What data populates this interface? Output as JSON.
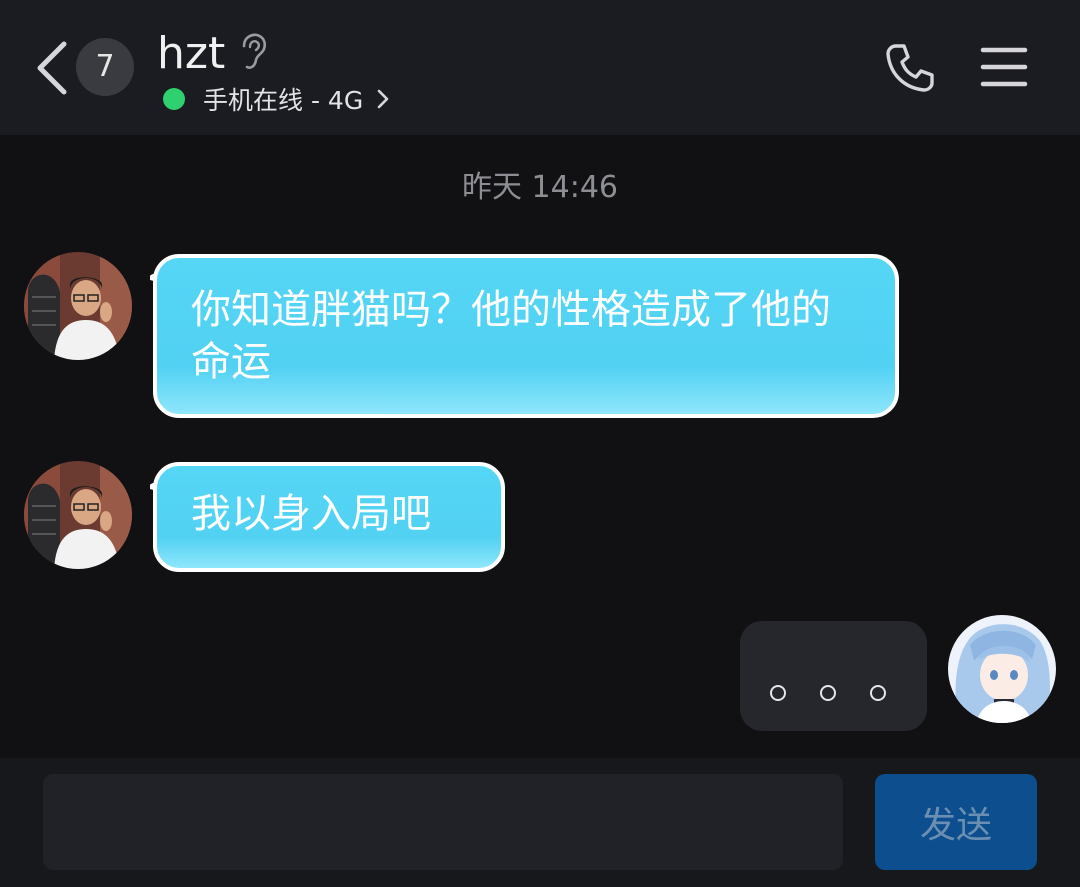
{
  "header": {
    "unread_count": "7",
    "contact_name": "hzt",
    "status_text": "手机在线 - 4G"
  },
  "chat": {
    "timestamp": "昨天 14:46",
    "messages": [
      {
        "sender": "hzt",
        "text": "你知道胖猫吗？他的性格造成了他的命运"
      },
      {
        "sender": "hzt",
        "text": "我以身入局吧"
      },
      {
        "sender": "me",
        "text": "。。。"
      }
    ]
  },
  "input_bar": {
    "placeholder": "",
    "send_label": "发送"
  },
  "colors": {
    "accent_bubble": "#55d6f5",
    "online_dot": "#2fd06f",
    "send_button": "#0d4f8e"
  }
}
